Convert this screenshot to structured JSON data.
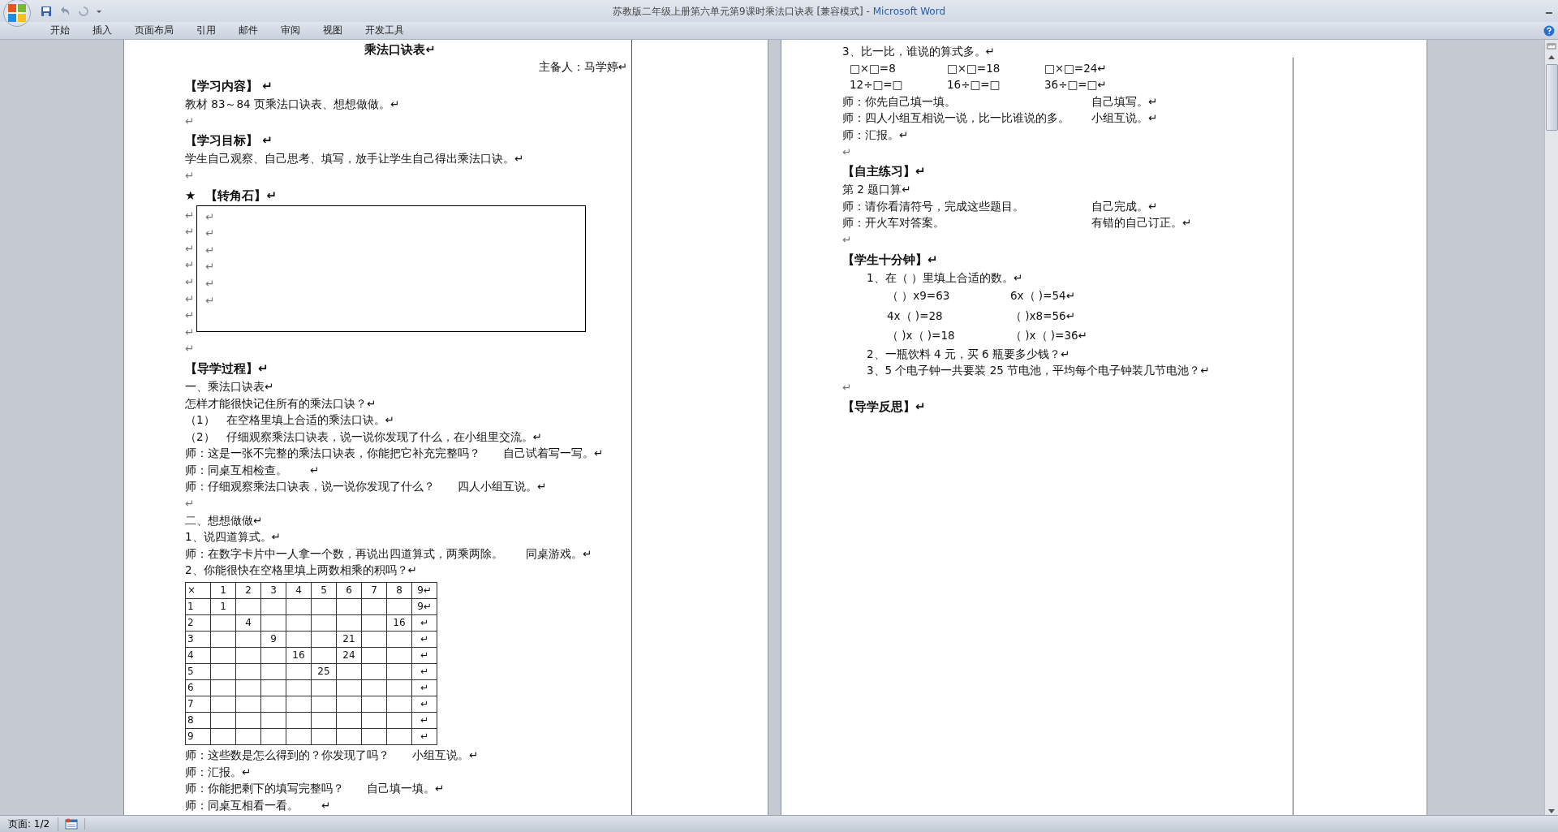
{
  "window": {
    "title": "苏教版二年级上册第六单元第9课时乘法口诀表 [兼容模式]",
    "separator": " - ",
    "app": "Microsoft Word"
  },
  "ribbon_tabs": [
    "开始",
    "插入",
    "页面布局",
    "引用",
    "邮件",
    "审阅",
    "视图",
    "开发工具"
  ],
  "pages": [
    {
      "lines": [
        {
          "kind": "title",
          "text": "乘法口诀表↵"
        },
        {
          "kind": "right",
          "text": "主备人：马学婷↵"
        },
        {
          "kind": "heading",
          "text": "【学习内容】 ↵"
        },
        {
          "kind": "text",
          "text": "教材 83～84 页乘法口诀表、想想做做。↵"
        },
        {
          "kind": "blank",
          "text": "↵"
        },
        {
          "kind": "heading",
          "text": "【学习目标】 ↵"
        },
        {
          "kind": "text",
          "text": "学生自己观察、自己思考、填写，放手让学生自己得出乘法口诀。↵"
        },
        {
          "kind": "blank",
          "text": "↵"
        },
        {
          "kind": "star-heading",
          "star": "★",
          "text": "【转角石】↵"
        },
        {
          "kind": "frame",
          "outside": [
            "↵",
            "↵",
            "↵",
            "↵",
            "↵",
            "↵",
            "↵",
            "↵"
          ],
          "inside": [
            "↵",
            "↵",
            "↵",
            "↵",
            "↵",
            "↵"
          ]
        },
        {
          "kind": "blank",
          "text": "↵"
        },
        {
          "kind": "heading",
          "text": "【导学过程】↵"
        },
        {
          "kind": "text",
          "text": "一、乘法口诀表↵"
        },
        {
          "kind": "text",
          "text": "怎样才能很快记住所有的乘法口诀？↵"
        },
        {
          "kind": "text",
          "text": "（1）　在空格里填上合适的乘法口诀。↵"
        },
        {
          "kind": "text",
          "text": "（2）　仔细观察乘法口诀表，说一说你发现了什么，在小组里交流。↵"
        },
        {
          "kind": "pair",
          "text": "师：这是一张不完整的乘法口诀表，你能把它补充完整吗？",
          "right": "自己试着写一写。↵"
        },
        {
          "kind": "pair",
          "text": "师：同桌互相检查。",
          "right": "↵"
        },
        {
          "kind": "pair",
          "text": "师：仔细观察乘法口诀表，说一说你发现了什么？",
          "right": "四人小组互说。↵"
        },
        {
          "kind": "blank",
          "text": "↵"
        },
        {
          "kind": "text",
          "text": "二、想想做做↵"
        },
        {
          "kind": "text",
          "text": "1、说四道算式。↵"
        },
        {
          "kind": "pair",
          "text": "师：在数字卡片中一人拿一个数，再说出四道算式，两乘两除。",
          "right": "同桌游戏。↵"
        },
        {
          "kind": "text",
          "text": "2、你能很快在空格里填上两数相乘的积吗？↵"
        },
        {
          "kind": "table",
          "rows": [
            [
              "×",
              "1",
              "2",
              "3",
              "4",
              "5",
              "6",
              "7",
              "8",
              "9↵"
            ],
            [
              "1",
              "1",
              "",
              "",
              "",
              "",
              "",
              "",
              "",
              "9↵"
            ],
            [
              "2",
              "",
              "4",
              "",
              "",
              "",
              "",
              "",
              "16",
              "↵"
            ],
            [
              "3",
              "",
              "",
              "9",
              "",
              "",
              "21",
              "",
              "",
              "↵"
            ],
            [
              "4",
              "",
              "",
              "",
              "16",
              "",
              "24",
              "",
              "",
              "↵"
            ],
            [
              "5",
              "",
              "",
              "",
              "",
              "25",
              "",
              "",
              "",
              "↵"
            ],
            [
              "6",
              "",
              "",
              "",
              "",
              "",
              "",
              "",
              "",
              "↵"
            ],
            [
              "7",
              "",
              "",
              "",
              "",
              "",
              "",
              "",
              "",
              "↵"
            ],
            [
              "8",
              "",
              "",
              "",
              "",
              "",
              "",
              "",
              "",
              "↵"
            ],
            [
              "9",
              "",
              "",
              "",
              "",
              "",
              "",
              "",
              "",
              "↵"
            ]
          ]
        },
        {
          "kind": "pair",
          "text": "师：这些数是怎么得到的？你发现了吗？",
          "right": "小组互说。↵"
        },
        {
          "kind": "text",
          "text": "师：汇报。↵"
        },
        {
          "kind": "pair",
          "text": "师：你能把剩下的填写完整吗？",
          "right": "自己填一填。↵"
        },
        {
          "kind": "pair",
          "text": "师：同桌互相看一看。",
          "right": "↵"
        }
      ]
    },
    {
      "lines": [
        {
          "kind": "text",
          "text": "3、比一比，谁说的算式多。↵"
        },
        {
          "kind": "eq-row",
          "cells": [
            "□×□=8",
            "□×□=18",
            "□×□=24↵"
          ]
        },
        {
          "kind": "eq-row",
          "cells": [
            "12÷□=□",
            "16÷□=□",
            "36÷□=□↵"
          ]
        },
        {
          "kind": "pair",
          "text": "师：你先自己填一填。",
          "right": "自己填写。↵"
        },
        {
          "kind": "pair",
          "text": "师：四人小组互相说一说，比一比谁说的多。",
          "right": "小组互说。↵"
        },
        {
          "kind": "text",
          "text": "师：汇报。↵"
        },
        {
          "kind": "blank",
          "text": "↵"
        },
        {
          "kind": "heading",
          "text": "【自主练习】↵"
        },
        {
          "kind": "text",
          "text": "第 2 题口算↵"
        },
        {
          "kind": "pair",
          "text": "师：请你看清符号，完成这些题目。",
          "right": "自己完成。↵"
        },
        {
          "kind": "pair",
          "text": "师：开火车对答案。",
          "right": "有错的自己订正。↵"
        },
        {
          "kind": "blank",
          "text": "↵"
        },
        {
          "kind": "heading",
          "text": "【学生十分钟】↵"
        },
        {
          "kind": "item",
          "text": "1、在（ ）里填上合适的数。↵"
        },
        {
          "kind": "fill-row",
          "cells": [
            "（ ）x9=63",
            "6x（ )=54↵"
          ]
        },
        {
          "kind": "fill-row",
          "cells": [
            "4x（ )=28",
            "（ )x8=56↵"
          ]
        },
        {
          "kind": "fill-row",
          "cells": [
            "（ )x（ )=18",
            "（ )x（ )=36↵"
          ]
        },
        {
          "kind": "item",
          "text": "2、一瓶饮料 4 元，买 6 瓶要多少钱？↵"
        },
        {
          "kind": "item",
          "text": "3、5 个电子钟一共要装 25 节电池，平均每个电子钟装几节电池？↵"
        },
        {
          "kind": "blank",
          "text": "↵"
        },
        {
          "kind": "heading",
          "text": "【导学反思】↵"
        }
      ]
    }
  ],
  "status_bar": {
    "page": "页面: 1/2"
  }
}
